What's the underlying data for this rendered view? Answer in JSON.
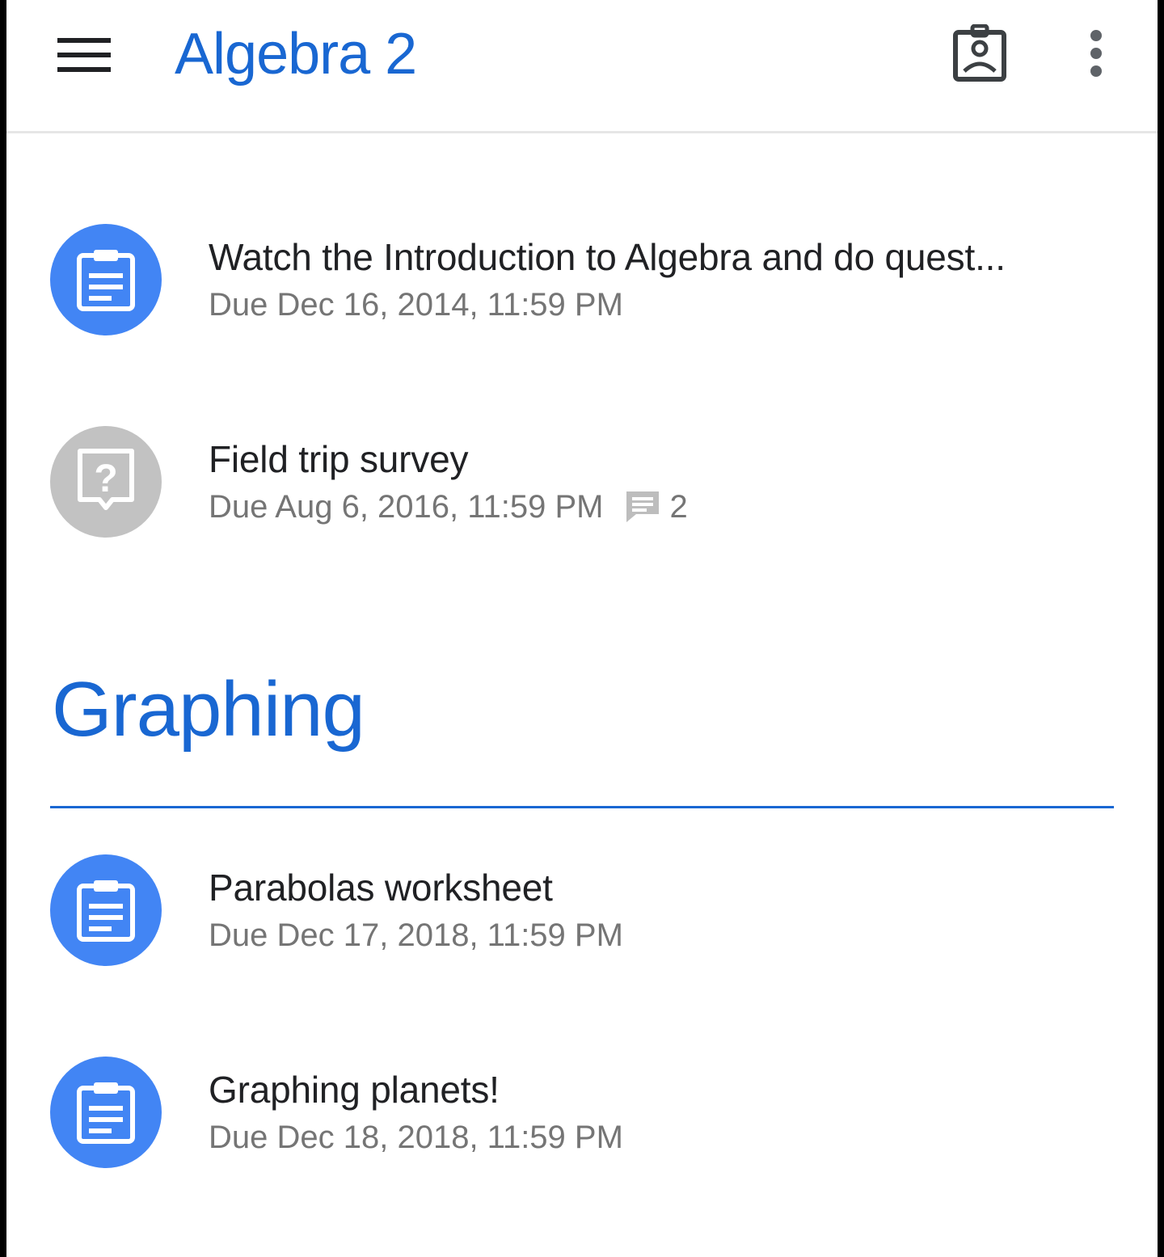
{
  "app_bar": {
    "title": "Algebra 2",
    "menu_icon": "hamburger-menu-icon",
    "classwork_icon": "assignment-ind-icon",
    "more_icon": "more-vert-icon"
  },
  "colors": {
    "accent": "#1967d2",
    "assignment_avatar": "#4285f4",
    "question_avatar": "#c2c2c2",
    "secondary_text": "#757575"
  },
  "items_top": [
    {
      "title": "Watch the Introduction to Algebra and do quest...",
      "due": "Due Dec 16, 2014, 11:59 PM",
      "icon": "assignment-icon"
    },
    {
      "title": "Field trip survey",
      "due": "Due Aug 6, 2016, 11:59 PM",
      "icon": "question-icon",
      "comments": "2"
    }
  ],
  "section": {
    "title": "Graphing",
    "items": [
      {
        "title": "Parabolas worksheet",
        "due": "Due Dec 17, 2018, 11:59 PM",
        "icon": "assignment-icon"
      },
      {
        "title": "Graphing planets!",
        "due": "Due Dec 18, 2018, 11:59 PM",
        "icon": "assignment-icon"
      }
    ]
  }
}
